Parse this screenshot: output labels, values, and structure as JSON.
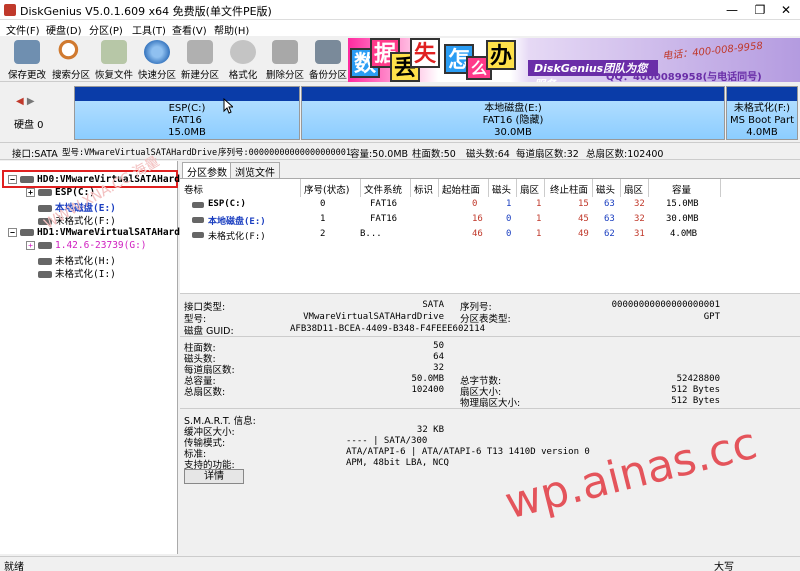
{
  "window": {
    "title": "DiskGenius V5.0.1.609 x64 免费版(单文件PE版)",
    "minimize": "—",
    "maximize": "❐",
    "close": "✕"
  },
  "menu": [
    "文件(F)",
    "硬盘(D)",
    "分区(P)",
    "工具(T)",
    "查看(V)",
    "帮助(H)"
  ],
  "toolbar": [
    {
      "label": "保存更改",
      "icon": "save-icon",
      "color": "#6f8fb0"
    },
    {
      "label": "搜索分区",
      "icon": "magnifier-icon",
      "color": "#d07a30"
    },
    {
      "label": "恢复文件",
      "icon": "recover-file-icon",
      "color": "#7a9a6a"
    },
    {
      "label": "快速分区",
      "icon": "quick-partition-icon",
      "color": "#3a78c0"
    },
    {
      "label": "新建分区",
      "icon": "new-partition-icon",
      "color": "#8a8a8a"
    },
    {
      "label": "格式化",
      "icon": "format-icon",
      "color": "#9a9a9a"
    },
    {
      "label": "删除分区",
      "icon": "delete-partition-icon",
      "color": "#8a8a8a"
    },
    {
      "label": "备份分区",
      "icon": "backup-partition-icon",
      "color": "#5a6a7a"
    }
  ],
  "banner": {
    "chars": [
      "数",
      "据",
      "丢",
      "失",
      "怎",
      "么",
      "办"
    ],
    "brand": "DiskGenius团队为您服务",
    "phone": "电话：400-008-9958",
    "qq": "QQ：4000089958(与电话同号)"
  },
  "diskmap": {
    "nav_left": "◀",
    "nav_right": "▶",
    "disk_label": "硬盘 0",
    "partitions": [
      {
        "name": "ESP(C:)",
        "fs": "FAT16",
        "size": "15.0MB"
      },
      {
        "name": "本地磁盘(E:)",
        "fs": "FAT16 (隐藏)",
        "size": "30.0MB"
      },
      {
        "name": "未格式化(F:)",
        "fs": "MS Boot Part",
        "size": "4.0MB"
      }
    ]
  },
  "infoline": {
    "interface": "接口:SATA",
    "model": "型号:VMwareVirtualSATAHardDrive",
    "serial": "序列号:00000000000000000001",
    "capacity": "容量:50.0MB",
    "cylinders": "柱面数:50",
    "heads": "磁头数:64",
    "sectors": "每道扇区数:32",
    "total_sectors": "总扇区数:102400"
  },
  "tree": {
    "hd0": "HD0:VMwareVirtualSATAHard",
    "hd0_parts": [
      "ESP(C:)",
      "本地磁盘(E:)",
      "未格式化(F:)"
    ],
    "hd1": "HD1:VMwareVirtualSATAHard",
    "hd1_parts": [
      "1.42.6-23739(G:)",
      "未格式化(H:)",
      "未格式化(I:)"
    ]
  },
  "tabs": [
    "分区参数",
    "浏览文件"
  ],
  "table": {
    "headers": [
      "卷标",
      "序号(状态)",
      "文件系统",
      "标识",
      "起始柱面",
      "磁头",
      "扇区",
      "终止柱面",
      "磁头",
      "扇区",
      "容量"
    ],
    "rows": [
      [
        "ESP(C:)",
        "0",
        "FAT16",
        "",
        "0",
        "1",
        "1",
        "15",
        "63",
        "32",
        "15.0MB"
      ],
      [
        "本地磁盘(E:)",
        "1",
        "FAT16",
        "",
        "16",
        "0",
        "1",
        "45",
        "63",
        "32",
        "30.0MB"
      ],
      [
        "未格式化(F:)",
        "2",
        "B...",
        "",
        "46",
        "0",
        "1",
        "49",
        "62",
        "31",
        "4.0MB"
      ]
    ]
  },
  "details": {
    "interface_label": "接口类型:",
    "interface": "SATA",
    "serial_label": "序列号:",
    "serial": "00000000000000000001",
    "model_label": "型号:",
    "model": "VMwareVirtualSATAHardDrive",
    "ptable_label": "分区表类型:",
    "ptable": "GPT",
    "guid_label": "磁盘 GUID:",
    "guid": "AFB38D11-BCEA-4409-B348-F4FEEE602114",
    "cyl_label": "柱面数:",
    "cyl": "50",
    "heads_label": "磁头数:",
    "heads": "64",
    "spt_label": "每道扇区数:",
    "spt": "32",
    "cap_label": "总容量:",
    "cap": "50.0MB",
    "bytes_label": "总字节数:",
    "bytes": "52428800",
    "sec_label": "总扇区数:",
    "sec": "102400",
    "secsize_label": "扇区大小:",
    "secsize": "512 Bytes",
    "physsec_label": "物理扇区大小:",
    "physsec": "512 Bytes",
    "smart_label": "S.M.A.R.T. 信息:",
    "buffer_label": "缓冲区大小:",
    "buffer": "32 KB",
    "transfer_label": "传输模式:",
    "transfer": "---- | SATA/300",
    "standard_label": "标准:",
    "standard": "ATA/ATAPI-6 | ATA/ATAPI-6 T13 1410D version 0",
    "features_label": "支持的功能:",
    "features": "APM, 48bit LBA, NCQ",
    "button": "详情"
  },
  "status": {
    "left": "就绪",
    "right": "大写"
  },
  "watermark": "wp.ainas.cc",
  "faint_watermark": "WWW.XNA.CC 海量"
}
